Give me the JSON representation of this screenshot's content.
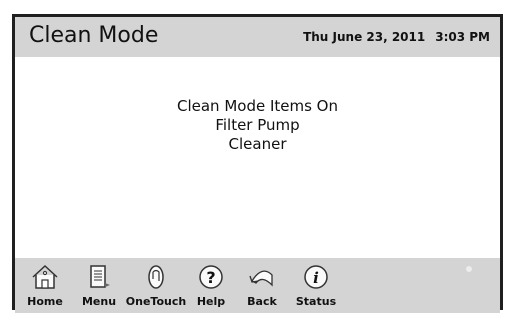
{
  "header": {
    "title": "Clean Mode",
    "date": "Thu June 23, 2011",
    "time": "3:03 PM"
  },
  "main": {
    "lines": [
      "Clean Mode Items On",
      "Filter Pump",
      "Cleaner"
    ]
  },
  "footer": {
    "buttons": [
      {
        "label": "Home",
        "icon": "house-icon"
      },
      {
        "label": "Menu",
        "icon": "document-icon"
      },
      {
        "label": "OneTouch",
        "icon": "hand-icon"
      },
      {
        "label": "Help",
        "icon": "question-mark-icon"
      },
      {
        "label": "Back",
        "icon": "back-arrow-icon"
      },
      {
        "label": "Status",
        "icon": "info-icon"
      }
    ]
  },
  "colors": {
    "bar_background": "#d4d4d4",
    "frame": "#1f1f1f"
  }
}
